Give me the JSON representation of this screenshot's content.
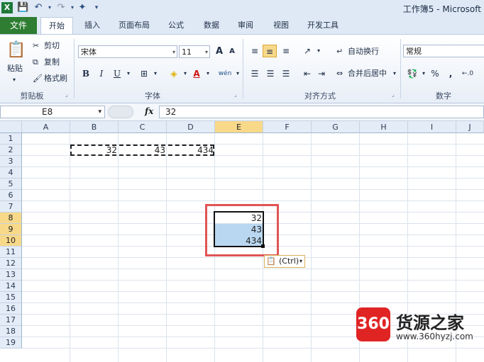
{
  "window": {
    "title": "工作簿5 - Microsoft"
  },
  "qat": {
    "excel_icon": "excel-icon",
    "save_icon": "save-icon",
    "undo_icon": "undo-icon",
    "redo_icon": "redo-icon",
    "customize_icon": "wand-icon"
  },
  "tabs": [
    {
      "label": "文件"
    },
    {
      "label": "开始"
    },
    {
      "label": "插入"
    },
    {
      "label": "页面布局"
    },
    {
      "label": "公式"
    },
    {
      "label": "数据"
    },
    {
      "label": "审阅"
    },
    {
      "label": "视图"
    },
    {
      "label": "开发工具"
    }
  ],
  "ribbon": {
    "clipboard": {
      "paste": "粘贴",
      "cut": "剪切",
      "copy": "复制",
      "format_painter": "格式刷",
      "group": "剪贴板"
    },
    "font": {
      "name": "宋体",
      "size": "11",
      "grow": "A",
      "shrink": "A",
      "bold": "B",
      "italic": "I",
      "underline": "U",
      "group": "字体",
      "phonetic": "wén"
    },
    "alignment": {
      "wrap": "自动换行",
      "merge": "合并后居中",
      "group": "对齐方式"
    },
    "number": {
      "format": "常规",
      "percent": "%",
      "comma": ",",
      "group": "数字"
    }
  },
  "formula_bar": {
    "name_box": "E8",
    "fx": "fx",
    "value": "32"
  },
  "columns": [
    "A",
    "B",
    "C",
    "D",
    "E",
    "F",
    "G",
    "H",
    "I",
    "J"
  ],
  "rows": [
    "1",
    "2",
    "3",
    "4",
    "5",
    "6",
    "7",
    "8",
    "9",
    "10",
    "11",
    "12",
    "13",
    "14",
    "15",
    "16",
    "17",
    "18",
    "19"
  ],
  "cells": {
    "B2": "32",
    "C2": "43",
    "D2": "434",
    "E8": "32",
    "E9": "43",
    "E10": "434"
  },
  "paste_options": {
    "label": "(Ctrl)"
  },
  "watermark": {
    "logo": "360",
    "brand": "货源之家",
    "url": "www.360hyzj.com"
  },
  "colors": {
    "file_tab": "#2e7d32",
    "selection": "#b9d7f1",
    "highlight_header": "#f8d98a",
    "annotation": "#e05555"
  }
}
